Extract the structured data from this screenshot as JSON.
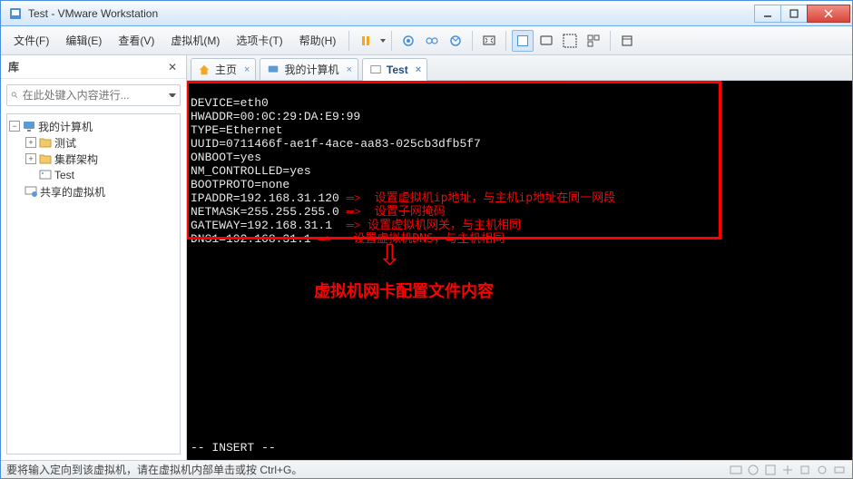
{
  "window": {
    "title": "Test - VMware Workstation"
  },
  "menu": {
    "file": "文件(F)",
    "edit": "编辑(E)",
    "view": "查看(V)",
    "vm": "虚拟机(M)",
    "tabs": "选项卡(T)",
    "help": "帮助(H)"
  },
  "sidebar": {
    "header": "库",
    "search_placeholder": "在此处键入内容进行...",
    "root": "我的计算机",
    "items": [
      "测试",
      "集群架构",
      "Test"
    ],
    "shared": "共享的虚拟机"
  },
  "tabs": {
    "home": "主页",
    "mypc": "我的计算机",
    "test": "Test"
  },
  "terminal": {
    "lines": [
      "DEVICE=eth0",
      "HWADDR=00:0C:29:DA:E9:99",
      "TYPE=Ethernet",
      "UUID=0711466f-ae1f-4ace-aa83-025cb3dfb5f7",
      "ONBOOT=yes",
      "NM_CONTROLLED=yes",
      "BOOTPROTO=none",
      "IPADDR=192.168.31.120",
      "NETMASK=255.255.255.0",
      "GATEWAY=192.168.31.1",
      "DNS1=192.168.31.1"
    ],
    "mode": "-- INSERT --",
    "annotations": {
      "ipaddr": "设置虚拟机ip地址，与主机ip地址在同一网段",
      "netmask": "设置子网掩码",
      "gateway": "设置虚拟机网关，与主机相同",
      "dns": "设置虚拟机DNS，与主机相同",
      "summary": "虚拟机网卡配置文件内容"
    }
  },
  "status": {
    "text": "要将输入定向到该虚拟机，请在虚拟机内部单击或按 Ctrl+G。"
  }
}
